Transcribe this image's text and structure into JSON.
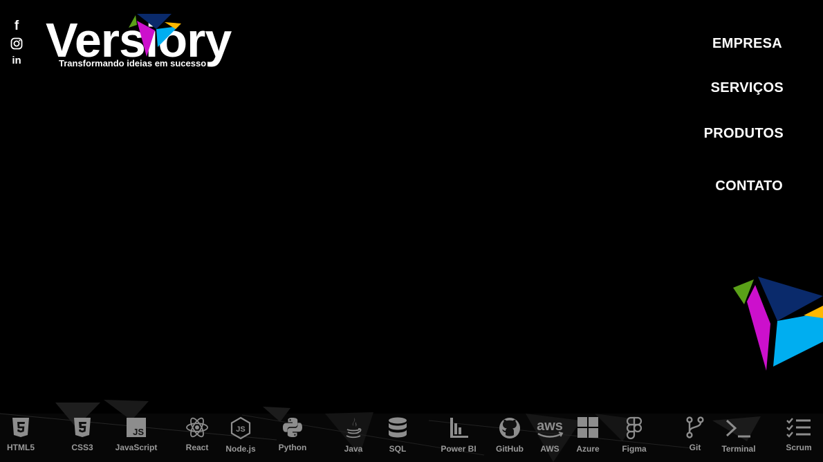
{
  "brand": {
    "name": "Versiory",
    "tagline": "Transformando ideias em sucesso",
    "colors": {
      "navy": "#0a2a6b",
      "magenta": "#cc10cc",
      "cyan": "#00aef0",
      "yellow": "#ffb800",
      "green": "#5aa018"
    }
  },
  "social": [
    {
      "icon": "facebook-icon",
      "glyph": "f"
    },
    {
      "icon": "instagram-icon",
      "glyph": ""
    },
    {
      "icon": "linkedin-icon",
      "glyph": "in"
    }
  ],
  "nav": [
    {
      "label": "EMPRESA"
    },
    {
      "label": "SERVIÇOS"
    },
    {
      "label": "PRODUTOS"
    },
    {
      "label": "CONTATO"
    }
  ],
  "tech": [
    {
      "label": "HTML5",
      "icon": "html5-icon"
    },
    {
      "label": "CSS3",
      "icon": "css3-icon"
    },
    {
      "label": "JavaScript",
      "icon": "javascript-icon"
    },
    {
      "label": "React",
      "icon": "react-icon"
    },
    {
      "label": "Node.js",
      "icon": "nodejs-icon"
    },
    {
      "label": "Python",
      "icon": "python-icon"
    },
    {
      "label": "Java",
      "icon": "java-icon"
    },
    {
      "label": "SQL",
      "icon": "database-icon"
    },
    {
      "label": "Power BI",
      "icon": "powerbi-icon"
    },
    {
      "label": "GitHub",
      "icon": "github-icon"
    },
    {
      "label": "AWS",
      "icon": "aws-icon"
    },
    {
      "label": "Azure",
      "icon": "azure-icon"
    },
    {
      "label": "Figma",
      "icon": "figma-icon"
    },
    {
      "label": "Git",
      "icon": "git-icon"
    },
    {
      "label": "Terminal",
      "icon": "terminal-icon"
    },
    {
      "label": "Scrum",
      "icon": "scrum-icon"
    }
  ]
}
